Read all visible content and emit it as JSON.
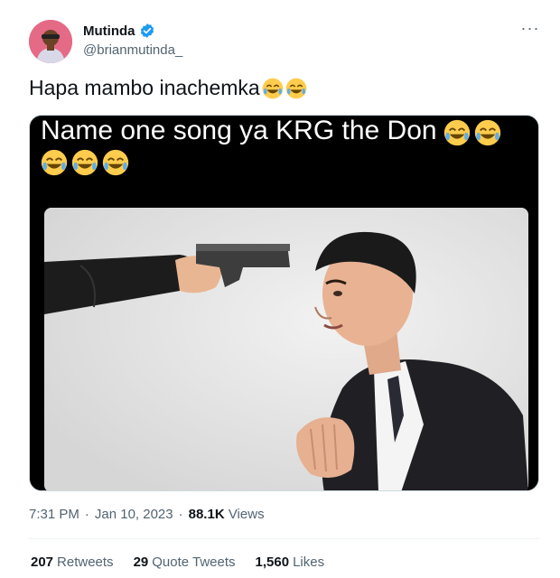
{
  "author": {
    "display_name": "Mutinda",
    "handle": "@brianmutinda_",
    "verified": true,
    "avatar_icon": "avatar-photo",
    "verified_color": "#1d9bf0"
  },
  "more_label": "···",
  "tweet": {
    "text": "Hapa mambo inachemka",
    "trailing_emoji": [
      "joy-emoji",
      "joy-emoji"
    ]
  },
  "media": {
    "caption_line1": "Name one song ya KRG the Don",
    "caption_emoji_count_line1": 2,
    "caption_emoji_count_line2": 3
  },
  "meta": {
    "time": "7:31 PM",
    "separator": "·",
    "date": "Jan 10, 2023",
    "separator2": "·",
    "views_count": "88.1K",
    "views_label": "Views"
  },
  "stats": [
    {
      "num": "207",
      "label": "Retweets"
    },
    {
      "num": "29",
      "label": "Quote Tweets"
    },
    {
      "num": "1,560",
      "label": "Likes"
    }
  ],
  "colors": {
    "text_primary": "#0f1419",
    "text_secondary": "#536471",
    "divider": "#eff3f4"
  }
}
